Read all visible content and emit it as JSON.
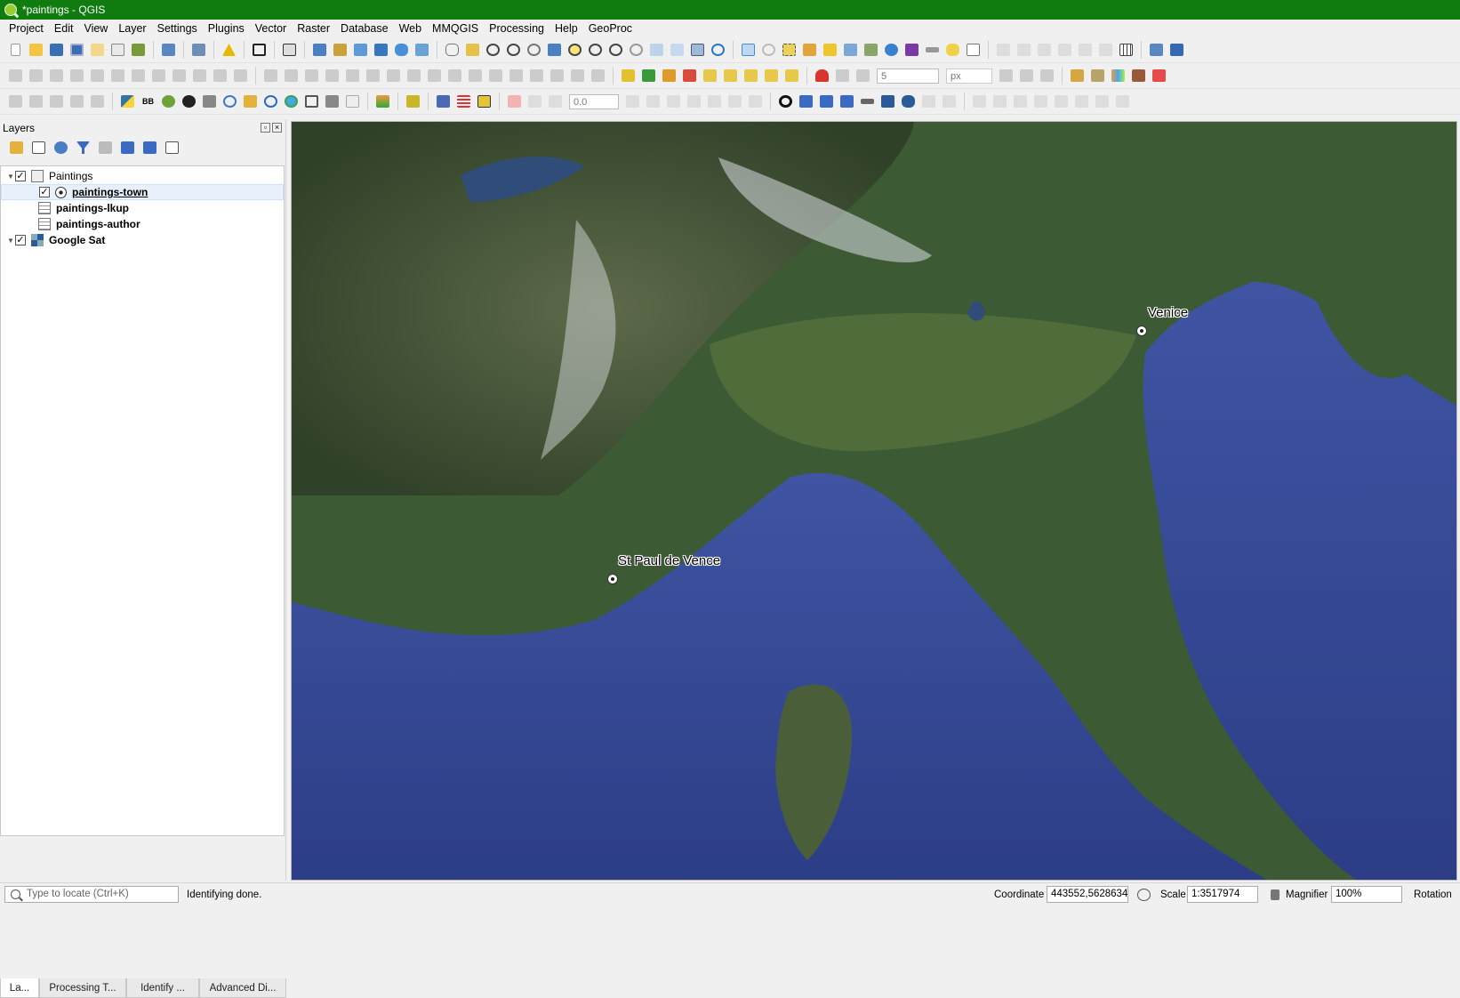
{
  "window": {
    "title": "*paintings - QGIS",
    "accent": "#107c10"
  },
  "menu": [
    "Project",
    "Edit",
    "View",
    "Layer",
    "Settings",
    "Plugins",
    "Vector",
    "Raster",
    "Database",
    "Web",
    "MMQGIS",
    "Processing",
    "Help",
    "GeoProc"
  ],
  "toolbar2": {
    "spin_value": "5",
    "unit": "px"
  },
  "toolbar3": {
    "spin_value": "0.0",
    "bb_label": "BB"
  },
  "layers": {
    "title": "Layers",
    "items": [
      {
        "label": "Paintings",
        "type": "group",
        "checked": true
      },
      {
        "label": "paintings-town",
        "type": "point",
        "checked": true
      },
      {
        "label": "paintings-lkup",
        "type": "table"
      },
      {
        "label": "paintings-author",
        "type": "table"
      },
      {
        "label": "Google Sat",
        "type": "raster",
        "checked": true
      }
    ]
  },
  "tabs": [
    "La...",
    "Processing T...",
    "Identify ...",
    "Advanced Di..."
  ],
  "map": {
    "towns": [
      {
        "name": "Venice"
      },
      {
        "name": "St Paul de Vence"
      }
    ]
  },
  "status": {
    "locator_placeholder": "Type to locate (Ctrl+K)",
    "message": "Identifying done.",
    "coordinate_label": "Coordinate",
    "coordinate_value": "443552,5628634",
    "scale_label": "Scale",
    "scale_value": "1:3517974",
    "magnifier_label": "Magnifier",
    "magnifier_value": "100%",
    "rotation_label": "Rotation"
  }
}
